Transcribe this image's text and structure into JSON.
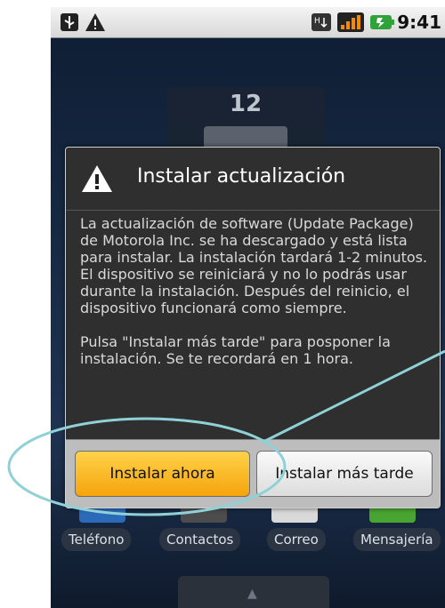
{
  "status_bar": {
    "time": "9:41",
    "icons": [
      "usb-icon",
      "warning-icon",
      "data-transfer-icon",
      "signal-icon",
      "battery-icon"
    ]
  },
  "home": {
    "clock_hour": "12",
    "dock": {
      "phone": "Teléfono",
      "contacts": "Contactos",
      "mail": "Correo",
      "messaging": "Mensajería"
    }
  },
  "dialog": {
    "title": "Instalar actualización",
    "body_p1": "La actualización de software (Update Package) de Motorola Inc. se ha descargado y está lista para instalar. La instalación tardará 1-2 minutos. El dispositivo se reiniciará y no lo podrás usar durante la instalación. Después del reinicio, el dispositivo funcionará como siempre.",
    "body_p2": "Pulsa \"Instalar más tarde\" para posponer la instalación. Se te recordará en 1 hora.",
    "install_now": "Instalar ahora",
    "install_later": "Instalar más tarde"
  },
  "colors": {
    "primary_button": "#f7b01e",
    "annotation": "#8fd1d6"
  }
}
